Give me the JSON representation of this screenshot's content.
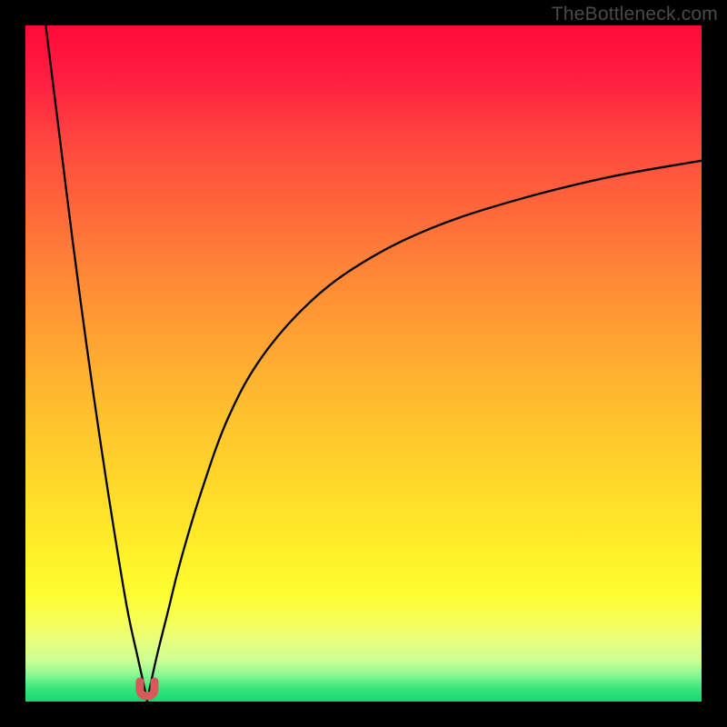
{
  "watermark": {
    "text": "TheBottleneck.com"
  },
  "colors": {
    "frame": "#000000",
    "curve_stroke": "#000000",
    "marker": "#d65a5a",
    "gradient_stops": [
      "#ff0a3a",
      "#ff1f41",
      "#ff4a3f",
      "#ff6a3a",
      "#ff8b36",
      "#ffa732",
      "#ffc22e",
      "#ffd92a",
      "#fff029",
      "#fdfd30",
      "#f6ff56",
      "#e8ff7e",
      "#caff94",
      "#8cf892",
      "#38e67e",
      "#17d873"
    ]
  },
  "chart_data": {
    "type": "line",
    "title": "",
    "xlabel": "",
    "ylabel": "",
    "xlim": [
      0,
      100
    ],
    "ylim": [
      0,
      100
    ],
    "grid": false,
    "legend": false,
    "description": "Bottleneck-style curve: y ≈ 0 at x ≈ 18 (optimal point), rising steeply to ~100 toward x=0 and asymptotically toward ~80 as x→100. Background is a vertical red→yellow→green gradient mapping y (higher = worse).",
    "series": [
      {
        "name": "left-branch",
        "x": [
          3,
          5,
          7,
          9,
          11,
          13,
          15,
          16.5,
          17.5,
          18
        ],
        "y": [
          100,
          84,
          68,
          53,
          39,
          26,
          14,
          7,
          2.5,
          0
        ]
      },
      {
        "name": "right-branch",
        "x": [
          18,
          18.5,
          19.5,
          21,
          23,
          26,
          30,
          35,
          42,
          50,
          60,
          72,
          86,
          100
        ],
        "y": [
          0,
          2.5,
          7,
          13,
          21,
          31,
          42,
          51,
          59,
          65,
          70,
          74,
          77.5,
          80
        ]
      }
    ],
    "marker": {
      "x": 18,
      "y": 0.8,
      "shape": "u",
      "color": "#d65a5a"
    }
  }
}
